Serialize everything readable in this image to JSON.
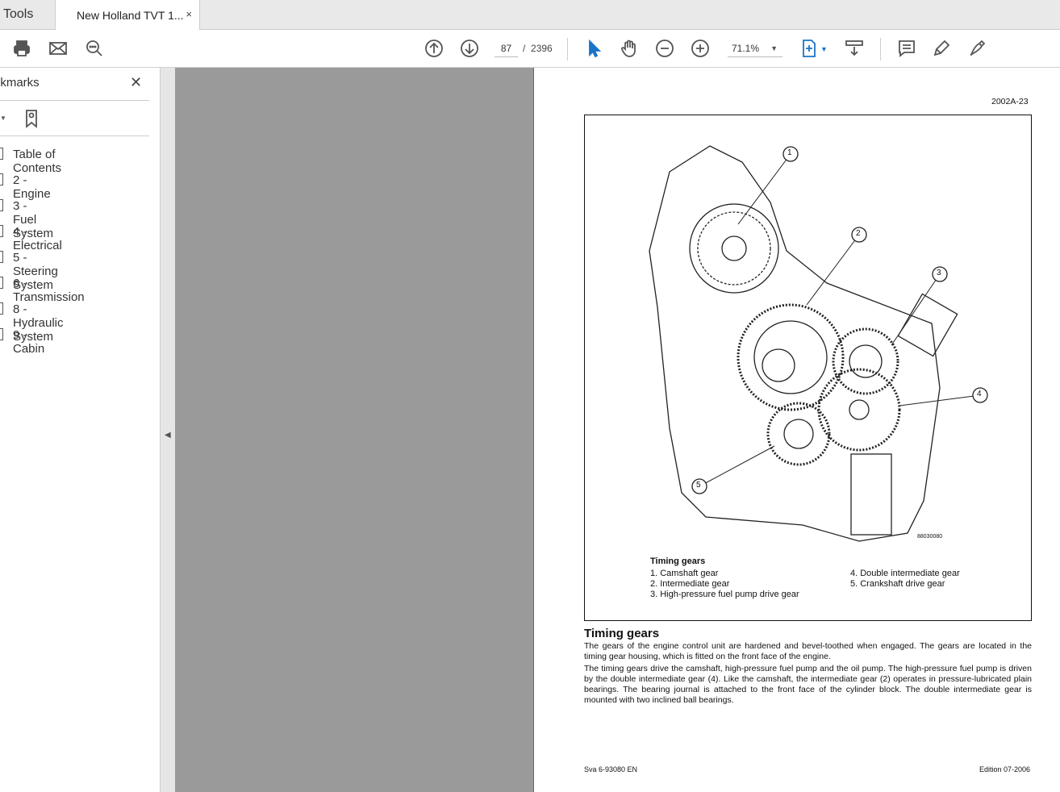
{
  "tabs": {
    "tools": "Tools",
    "document": "New Holland TVT 1...",
    "close": "×"
  },
  "toolbar": {
    "page_current": "87",
    "page_sep": "/",
    "page_total": "2396",
    "zoom": "71.1%"
  },
  "sidebar": {
    "title": "okmarks",
    "close": "✕",
    "items": [
      {
        "label": "Table of Contents"
      },
      {
        "label": "2 - Engine"
      },
      {
        "label": "3 - Fuel System"
      },
      {
        "label": "4 - Electrical"
      },
      {
        "label": "5 - Steering System"
      },
      {
        "label": "6 - Transmission"
      },
      {
        "label": "8 - Hydraulic System"
      },
      {
        "label": "9 - Cabin"
      }
    ]
  },
  "document": {
    "header_ref": "2002A-23",
    "figure_code": "88030080",
    "callouts": [
      "1",
      "2",
      "3",
      "4",
      "5"
    ],
    "caption_title": "Timing gears",
    "caption_items": [
      "1. Camshaft gear",
      "2. Intermediate gear",
      "3. High-pressure fuel pump drive gear",
      "4. Double intermediate gear",
      "5. Crankshaft drive gear"
    ],
    "heading": "Timing gears",
    "para1": "The gears of the engine control unit are hardened and bevel-toothed when engaged. The gears are located in the timing gear housing, which is fitted on the front face of the engine.",
    "para2": "The timing gears drive the camshaft, high-pressure fuel pump and the oil pump. The high-pressure fuel pump is driven by the double intermediate gear (4). Like the camshaft, the intermediate gear (2) operates in pressure-lubricated plain bearings. The bearing journal is attached to the front face of the cylinder block. The double intermediate gear is mounted with two inclined ball bearings.",
    "footer_left": "Sva 6-93080 EN",
    "footer_right": "Edition 07-2006"
  }
}
